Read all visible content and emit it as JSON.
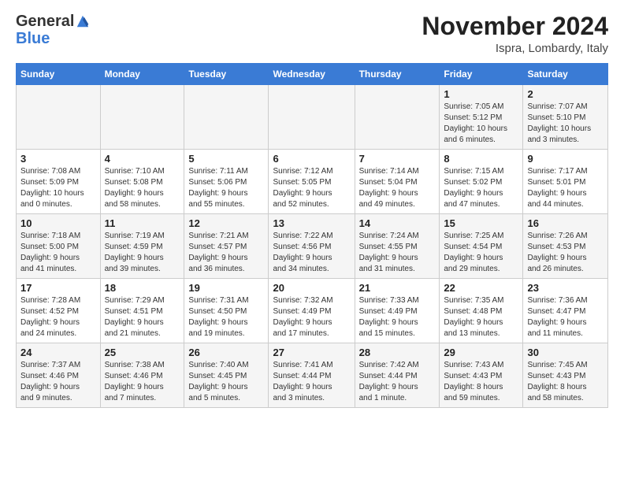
{
  "header": {
    "logo_line1": "General",
    "logo_line2": "Blue",
    "month": "November 2024",
    "location": "Ispra, Lombardy, Italy"
  },
  "weekdays": [
    "Sunday",
    "Monday",
    "Tuesday",
    "Wednesday",
    "Thursday",
    "Friday",
    "Saturday"
  ],
  "weeks": [
    [
      {
        "day": "",
        "info": ""
      },
      {
        "day": "",
        "info": ""
      },
      {
        "day": "",
        "info": ""
      },
      {
        "day": "",
        "info": ""
      },
      {
        "day": "",
        "info": ""
      },
      {
        "day": "1",
        "info": "Sunrise: 7:05 AM\nSunset: 5:12 PM\nDaylight: 10 hours\nand 6 minutes."
      },
      {
        "day": "2",
        "info": "Sunrise: 7:07 AM\nSunset: 5:10 PM\nDaylight: 10 hours\nand 3 minutes."
      }
    ],
    [
      {
        "day": "3",
        "info": "Sunrise: 7:08 AM\nSunset: 5:09 PM\nDaylight: 10 hours\nand 0 minutes."
      },
      {
        "day": "4",
        "info": "Sunrise: 7:10 AM\nSunset: 5:08 PM\nDaylight: 9 hours\nand 58 minutes."
      },
      {
        "day": "5",
        "info": "Sunrise: 7:11 AM\nSunset: 5:06 PM\nDaylight: 9 hours\nand 55 minutes."
      },
      {
        "day": "6",
        "info": "Sunrise: 7:12 AM\nSunset: 5:05 PM\nDaylight: 9 hours\nand 52 minutes."
      },
      {
        "day": "7",
        "info": "Sunrise: 7:14 AM\nSunset: 5:04 PM\nDaylight: 9 hours\nand 49 minutes."
      },
      {
        "day": "8",
        "info": "Sunrise: 7:15 AM\nSunset: 5:02 PM\nDaylight: 9 hours\nand 47 minutes."
      },
      {
        "day": "9",
        "info": "Sunrise: 7:17 AM\nSunset: 5:01 PM\nDaylight: 9 hours\nand 44 minutes."
      }
    ],
    [
      {
        "day": "10",
        "info": "Sunrise: 7:18 AM\nSunset: 5:00 PM\nDaylight: 9 hours\nand 41 minutes."
      },
      {
        "day": "11",
        "info": "Sunrise: 7:19 AM\nSunset: 4:59 PM\nDaylight: 9 hours\nand 39 minutes."
      },
      {
        "day": "12",
        "info": "Sunrise: 7:21 AM\nSunset: 4:57 PM\nDaylight: 9 hours\nand 36 minutes."
      },
      {
        "day": "13",
        "info": "Sunrise: 7:22 AM\nSunset: 4:56 PM\nDaylight: 9 hours\nand 34 minutes."
      },
      {
        "day": "14",
        "info": "Sunrise: 7:24 AM\nSunset: 4:55 PM\nDaylight: 9 hours\nand 31 minutes."
      },
      {
        "day": "15",
        "info": "Sunrise: 7:25 AM\nSunset: 4:54 PM\nDaylight: 9 hours\nand 29 minutes."
      },
      {
        "day": "16",
        "info": "Sunrise: 7:26 AM\nSunset: 4:53 PM\nDaylight: 9 hours\nand 26 minutes."
      }
    ],
    [
      {
        "day": "17",
        "info": "Sunrise: 7:28 AM\nSunset: 4:52 PM\nDaylight: 9 hours\nand 24 minutes."
      },
      {
        "day": "18",
        "info": "Sunrise: 7:29 AM\nSunset: 4:51 PM\nDaylight: 9 hours\nand 21 minutes."
      },
      {
        "day": "19",
        "info": "Sunrise: 7:31 AM\nSunset: 4:50 PM\nDaylight: 9 hours\nand 19 minutes."
      },
      {
        "day": "20",
        "info": "Sunrise: 7:32 AM\nSunset: 4:49 PM\nDaylight: 9 hours\nand 17 minutes."
      },
      {
        "day": "21",
        "info": "Sunrise: 7:33 AM\nSunset: 4:49 PM\nDaylight: 9 hours\nand 15 minutes."
      },
      {
        "day": "22",
        "info": "Sunrise: 7:35 AM\nSunset: 4:48 PM\nDaylight: 9 hours\nand 13 minutes."
      },
      {
        "day": "23",
        "info": "Sunrise: 7:36 AM\nSunset: 4:47 PM\nDaylight: 9 hours\nand 11 minutes."
      }
    ],
    [
      {
        "day": "24",
        "info": "Sunrise: 7:37 AM\nSunset: 4:46 PM\nDaylight: 9 hours\nand 9 minutes."
      },
      {
        "day": "25",
        "info": "Sunrise: 7:38 AM\nSunset: 4:46 PM\nDaylight: 9 hours\nand 7 minutes."
      },
      {
        "day": "26",
        "info": "Sunrise: 7:40 AM\nSunset: 4:45 PM\nDaylight: 9 hours\nand 5 minutes."
      },
      {
        "day": "27",
        "info": "Sunrise: 7:41 AM\nSunset: 4:44 PM\nDaylight: 9 hours\nand 3 minutes."
      },
      {
        "day": "28",
        "info": "Sunrise: 7:42 AM\nSunset: 4:44 PM\nDaylight: 9 hours\nand 1 minute."
      },
      {
        "day": "29",
        "info": "Sunrise: 7:43 AM\nSunset: 4:43 PM\nDaylight: 8 hours\nand 59 minutes."
      },
      {
        "day": "30",
        "info": "Sunrise: 7:45 AM\nSunset: 4:43 PM\nDaylight: 8 hours\nand 58 minutes."
      }
    ]
  ]
}
